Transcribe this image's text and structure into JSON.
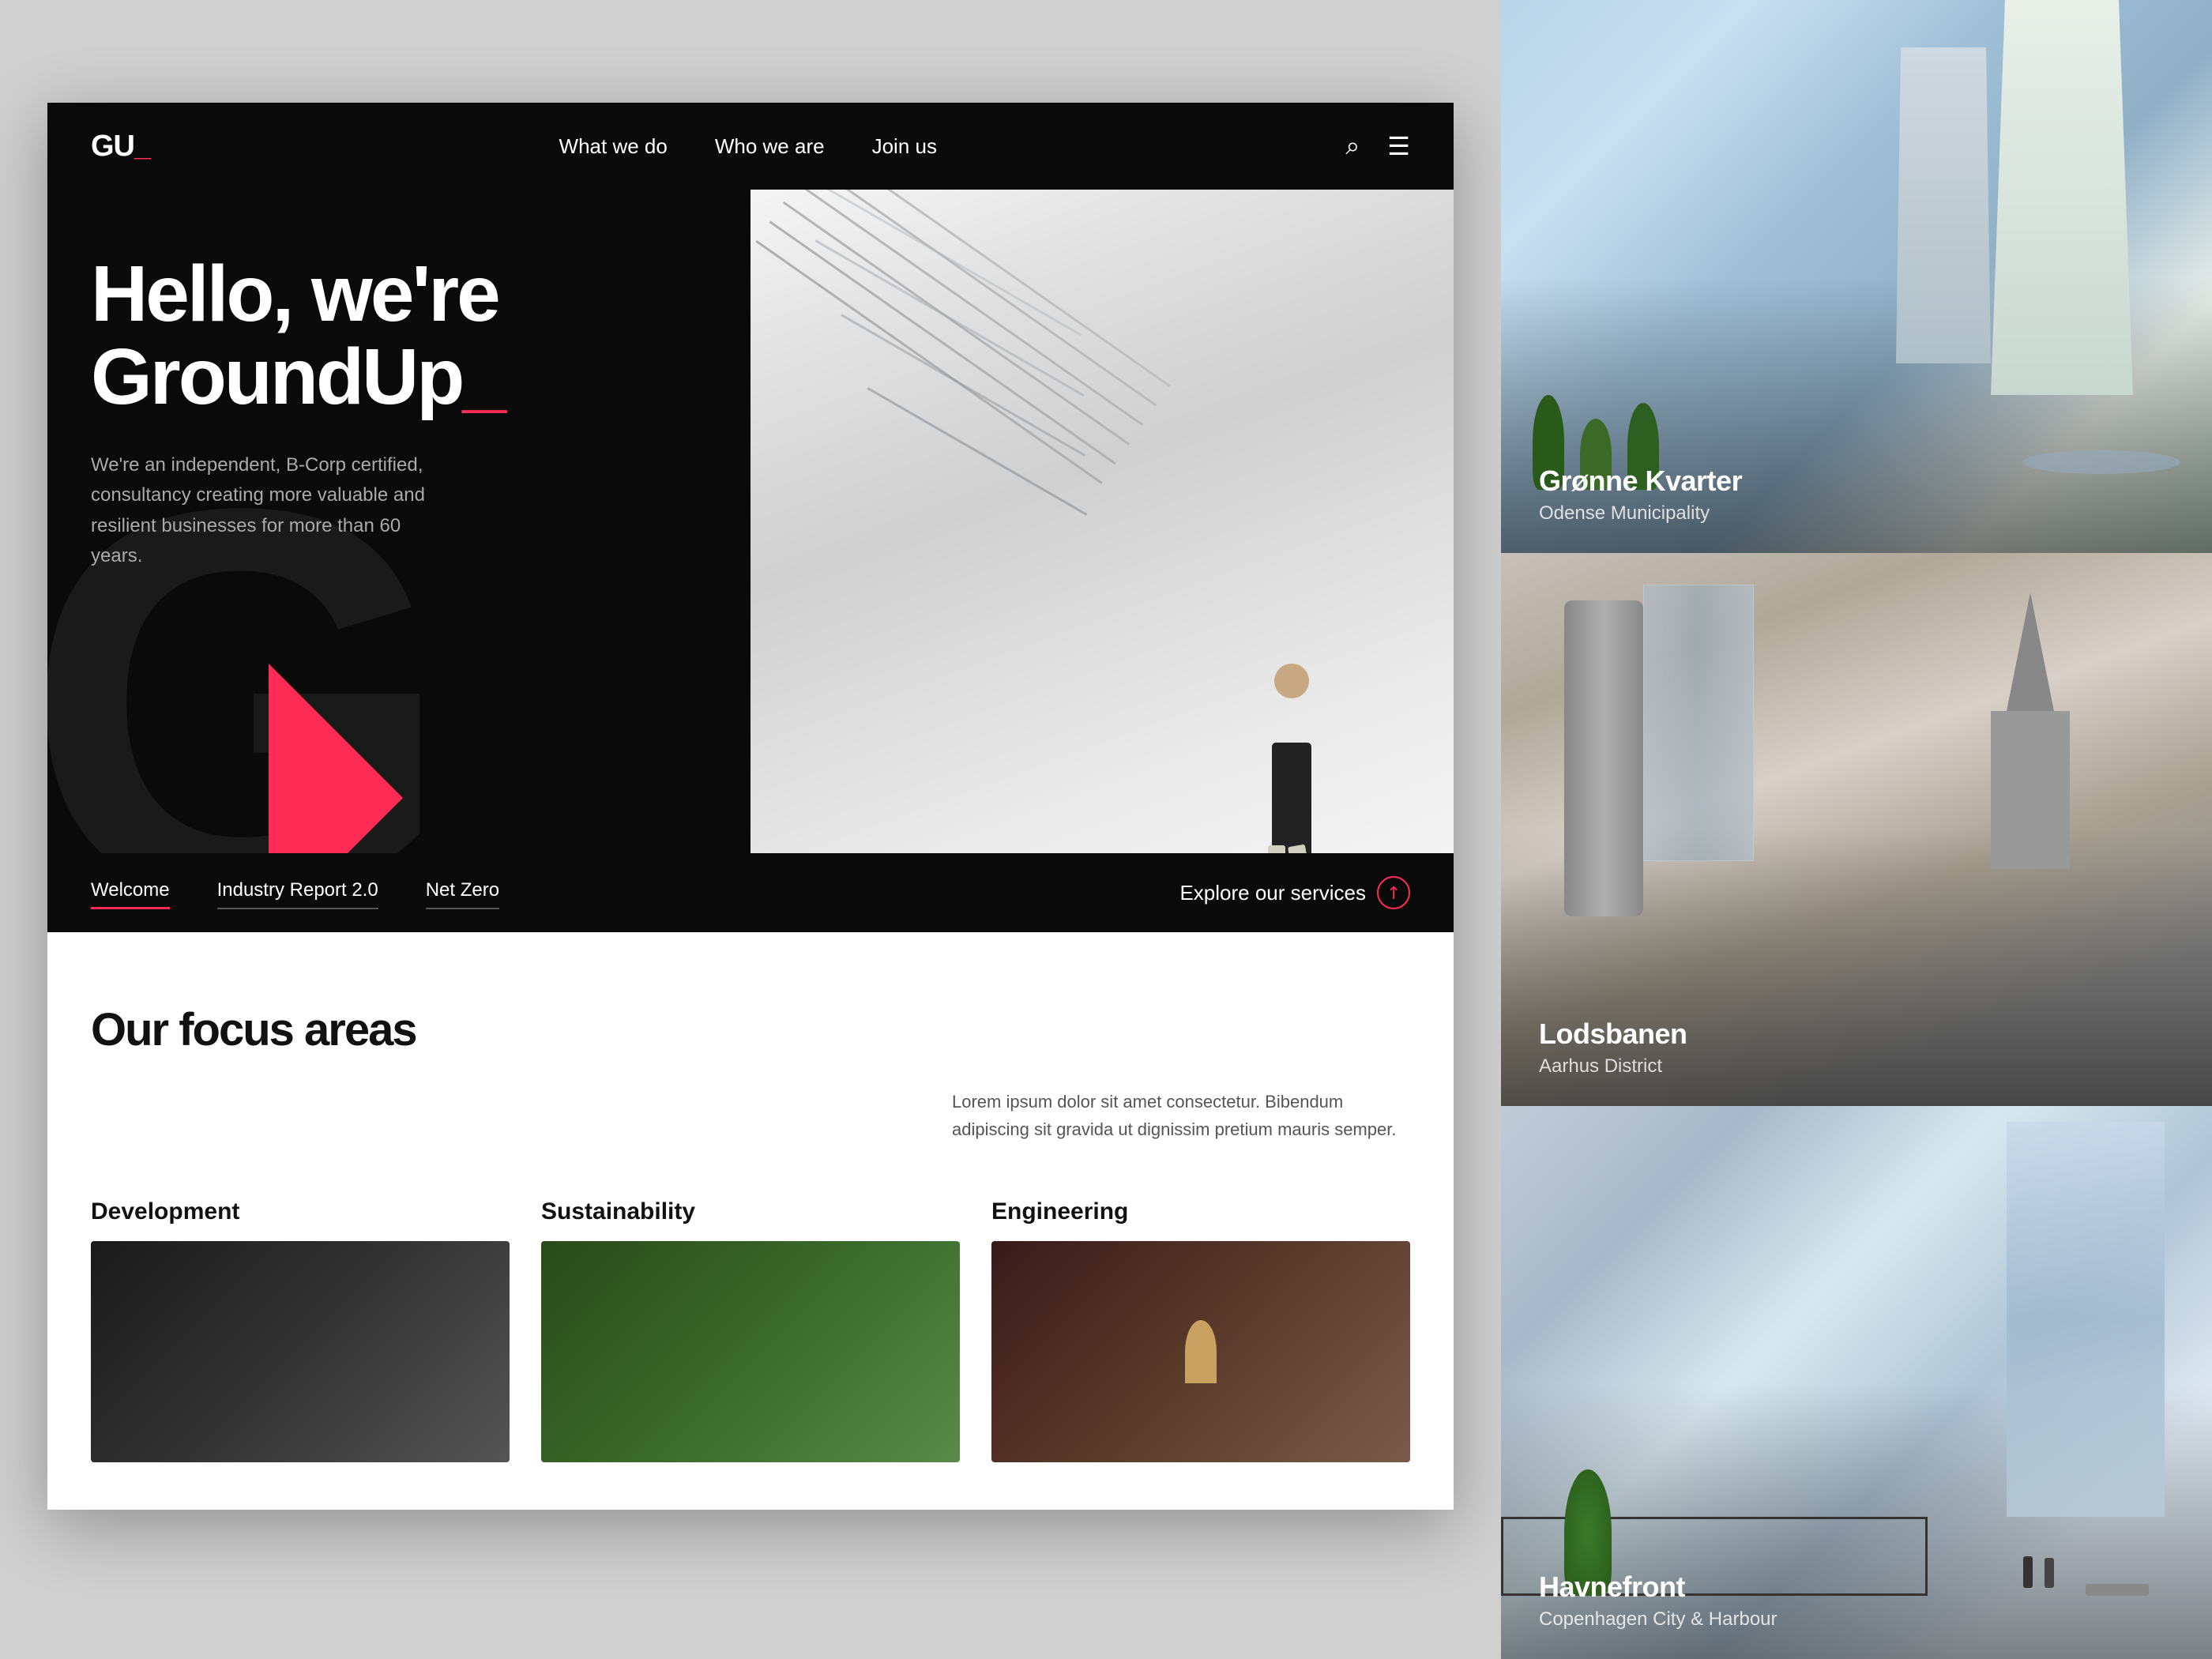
{
  "nav": {
    "logo": "GU_",
    "links": [
      {
        "label": "What we do",
        "href": "#"
      },
      {
        "label": "Who we are",
        "href": "#"
      },
      {
        "label": "Join us",
        "href": "#"
      }
    ]
  },
  "hero": {
    "title_line1": "Hello, we're",
    "title_line2": "GroundUp",
    "title_cursor": "_",
    "description": "We're an independent, B-Corp certified, consultancy creating more valuable and resilient businesses for more than 60 years.",
    "tabs": [
      {
        "label": "Welcome",
        "active": true
      },
      {
        "label": "Industry Report 2.0",
        "active": false
      },
      {
        "label": "Net Zero",
        "active": false
      }
    ],
    "explore_label": "Explore our services"
  },
  "focus": {
    "title": "Our focus areas",
    "description": "Lorem ipsum dolor sit amet consectetur. Bibendum adipiscing sit gravida ut dignissim pretium mauris semper.",
    "areas": [
      {
        "title": "Development"
      },
      {
        "title": "Sustainability"
      },
      {
        "title": "Engineering"
      }
    ]
  },
  "sidebar": {
    "cards": [
      {
        "title": "Grønne Kvarter",
        "subtitle": "Odense Municipality"
      },
      {
        "title": "Lodsbanen",
        "subtitle": "Aarhus District"
      },
      {
        "title": "Havnefront",
        "subtitle": "Copenhagen City & Harbour"
      }
    ]
  }
}
